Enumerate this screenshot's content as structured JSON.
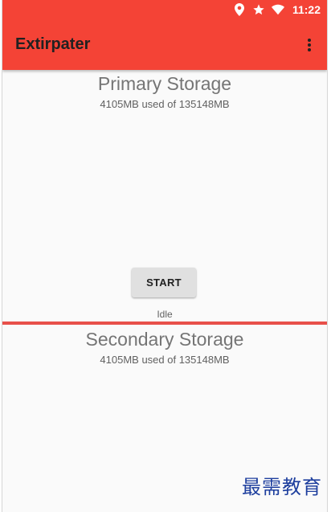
{
  "status_bar": {
    "time": "11:22",
    "icons": [
      "location-icon",
      "star-icon",
      "wifi-icon"
    ]
  },
  "toolbar": {
    "title": "Extirpater",
    "menu_icon": "more-vert-icon"
  },
  "primary": {
    "title": "Primary Storage",
    "usage": "4105MB  used of 135148MB"
  },
  "controls": {
    "start_label": "START",
    "status": "Idle"
  },
  "secondary": {
    "title": "Secondary Storage",
    "usage": "4105MB  used of 135148MB"
  },
  "watermark": "最需教育",
  "colors": {
    "app_bar": "#f44336",
    "divider": "#e8504a",
    "button": "#e0e0e0",
    "watermark": "#1e3f9e"
  }
}
